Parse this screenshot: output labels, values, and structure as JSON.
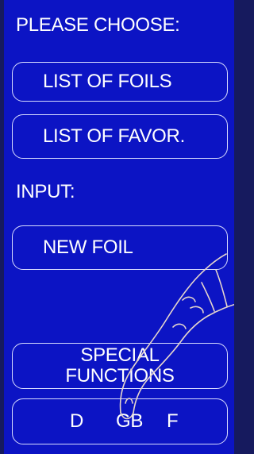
{
  "labels": {
    "please_choose": "PLEASE CHOOSE:",
    "input": "INPUT:"
  },
  "buttons": {
    "list_of_foils": "LIST OF FOILS",
    "list_of_favor": "LIST OF FAVOR.",
    "new_foil": "NEW FOIL",
    "special_line1": "SPECIAL",
    "special_line2": "FUNCTIONS"
  },
  "languages": [
    "D",
    "GB",
    "F"
  ],
  "colors": {
    "screen_bg": "#0c14c4",
    "frame_bg": "#161a5e",
    "text": "#ffffff",
    "border": "#d8dcff"
  },
  "decorations": {
    "pointer": "pointing-hand-icon"
  }
}
